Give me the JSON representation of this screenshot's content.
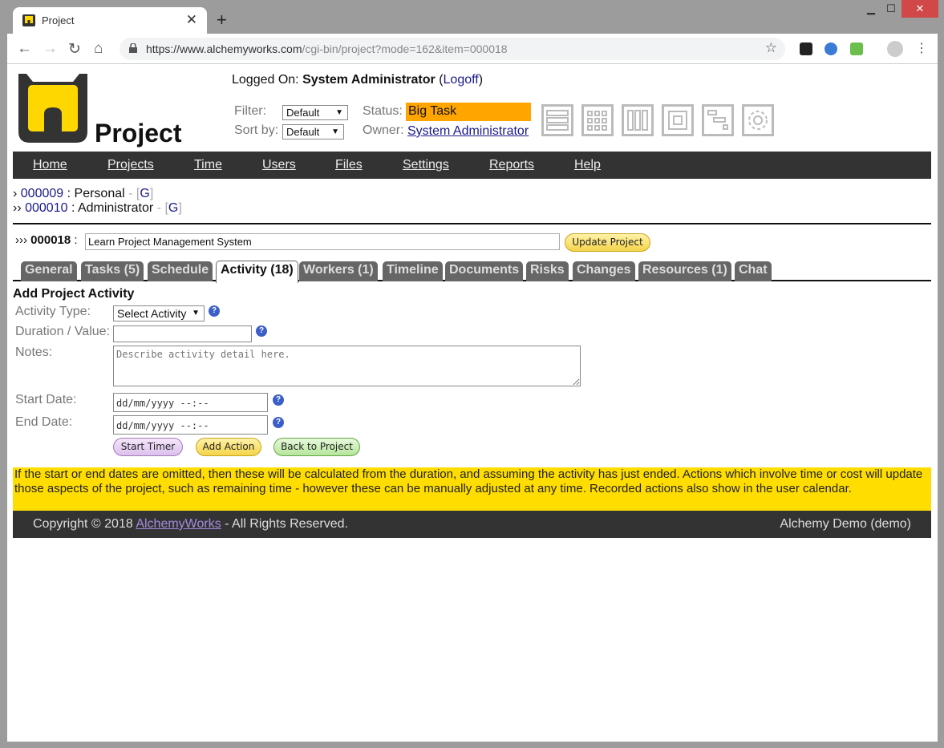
{
  "browser": {
    "tab_title": "Project",
    "url_host": "https://www.alchemyworks.com",
    "url_path": "/cgi-bin/project?mode=162&item=000018",
    "window_controls": [
      "minimize",
      "maximize",
      "close"
    ]
  },
  "header": {
    "app_title": "Project",
    "logged_on_label": "Logged On:",
    "user_name": "System Administrator",
    "logoff_label": "Logoff",
    "filter_label": "Filter:",
    "filter_value": "Default",
    "sort_label": "Sort by:",
    "sort_value": "Default",
    "status_label": "Status:",
    "status_value": "Big Task",
    "owner_label": "Owner:",
    "owner_value": "System Administrator",
    "view_icons": [
      "list-view-icon",
      "grid-view-icon",
      "column-view-icon",
      "single-view-icon",
      "gantt-view-icon",
      "settings-gear-icon"
    ]
  },
  "menu": [
    "Home",
    "Projects",
    "Time",
    "Users",
    "Files",
    "Settings",
    "Reports",
    "Help"
  ],
  "breadcrumbs": [
    {
      "prefix": "›",
      "id": "000009",
      "name": "Personal",
      "g": "G"
    },
    {
      "prefix": "››",
      "id": "000010",
      "name": "Administrator",
      "g": "G"
    }
  ],
  "project": {
    "prefix": "›››",
    "id": "000018",
    "name": "Learn Project Management System",
    "update_label": "Update Project"
  },
  "tabs": [
    {
      "label": "General",
      "active": false
    },
    {
      "label": "Tasks (5)",
      "active": false
    },
    {
      "label": "Schedule",
      "active": false
    },
    {
      "label": "Activity (18)",
      "active": true
    },
    {
      "label": "Workers (1)",
      "active": false
    },
    {
      "label": "Timeline",
      "active": false
    },
    {
      "label": "Documents",
      "active": false
    },
    {
      "label": "Risks",
      "active": false
    },
    {
      "label": "Changes",
      "active": false
    },
    {
      "label": "Resources (1)",
      "active": false
    },
    {
      "label": "Chat",
      "active": false
    }
  ],
  "form": {
    "heading": "Add Project Activity",
    "activity_type_label": "Activity Type:",
    "activity_type_value": "Select Activity",
    "duration_label": "Duration / Value:",
    "duration_value": "",
    "notes_label": "Notes:",
    "notes_placeholder": "Describe activity detail here.",
    "start_label": "Start Date:",
    "start_placeholder": "dd/mm/yyyy --:--",
    "end_label": "End Date:",
    "end_placeholder": "dd/mm/yyyy --:--",
    "start_timer_label": "Start Timer",
    "add_action_label": "Add Action",
    "back_label": "Back to Project"
  },
  "notice": "If the start or end dates are omitted, then these will be calculated from the duration, and assuming the activity has just ended. Actions which involve time or cost will update those aspects of the project, such as remaining time - however these can be manually adjusted at any time. Recorded actions also show in the user calendar.",
  "footer": {
    "copyright_prefix": "Copyright © 2018 ",
    "brand": "AlchemyWorks",
    "copyright_suffix": " - All Rights Reserved.",
    "instance": "Alchemy Demo (demo)"
  },
  "colors": {
    "status": "#ffa500",
    "notice": "#ffdd00",
    "menubar": "#333333",
    "link": "#1a1a8c"
  }
}
